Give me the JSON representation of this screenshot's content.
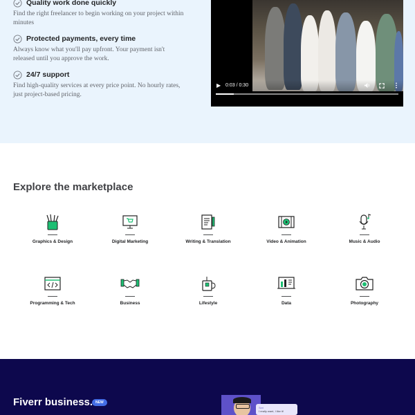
{
  "features": [
    {
      "title": "Quality work done quickly",
      "text": "Find the right freelancer to begin working on your project within minutes"
    },
    {
      "title": "Protected payments, every time",
      "text": "Always know what you'll pay upfront. Your payment isn't released until you approve the work."
    },
    {
      "title": "24/7 support",
      "text": "Find high-quality services at every price point. No hourly rates, just project-based pricing."
    }
  ],
  "video": {
    "time": "0:03 / 0:30",
    "progress": 0.1
  },
  "explore": {
    "title": "Explore the marketplace",
    "categories": [
      {
        "label": "Graphics & Design",
        "icon": "graphics-design-icon"
      },
      {
        "label": "Digital Marketing",
        "icon": "digital-marketing-icon"
      },
      {
        "label": "Writing & Translation",
        "icon": "writing-translation-icon"
      },
      {
        "label": "Video & Animation",
        "icon": "video-animation-icon"
      },
      {
        "label": "Music & Audio",
        "icon": "music-audio-icon"
      },
      {
        "label": "Programming & Tech",
        "icon": "programming-tech-icon"
      },
      {
        "label": "Business",
        "icon": "business-icon"
      },
      {
        "label": "Lifestyle",
        "icon": "lifestyle-icon"
      },
      {
        "label": "Data",
        "icon": "data-icon"
      },
      {
        "label": "Photography",
        "icon": "photography-icon"
      }
    ]
  },
  "business": {
    "title": "Fiverr business.",
    "badge": "NEW",
    "card_name": "Seri",
    "card_text": "I really want, I like it!"
  },
  "colors": {
    "top_bg": "#eaf4fd",
    "business_bg": "#0d084d",
    "icon_teal": "#1dbf73",
    "badge": "#446ee7"
  }
}
